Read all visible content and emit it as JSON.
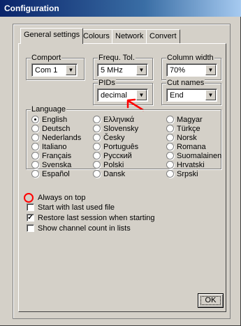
{
  "window": {
    "title": "Configuration"
  },
  "tabs": [
    {
      "label": "General settings"
    },
    {
      "label": "Colours"
    },
    {
      "label": "Network"
    },
    {
      "label": "Convert"
    }
  ],
  "comport": {
    "label": "Comport",
    "value": "Com 1"
  },
  "frequ_tol": {
    "label": "Frequ. Tol.",
    "value": "5 MHz"
  },
  "column_width": {
    "label": "Column width",
    "value": "70%"
  },
  "pids": {
    "label": "PIDs",
    "value": "decimal"
  },
  "cut_names": {
    "label": "Cut names",
    "value": "End"
  },
  "language": {
    "label": "Language",
    "selected": "English",
    "options": [
      "English",
      "Deutsch",
      "Nederlands",
      "Italiano",
      "Français",
      "Svenska",
      "Español",
      "Ελληνικά",
      "Slovensky",
      "Česky",
      "Português",
      "Русский",
      "Polski",
      "Dansk",
      "Magyar",
      "Türkçe",
      "Norsk",
      "Romana",
      "Suomalainen",
      "Hrvatski",
      "Srpski"
    ]
  },
  "options": [
    {
      "label": "Always on top",
      "checked": false
    },
    {
      "label": "Start with last used file",
      "checked": false
    },
    {
      "label": "Restore last session when starting",
      "checked": true
    },
    {
      "label": "Show channel count in lists",
      "checked": false
    }
  ],
  "ok_button": {
    "label": "OK"
  },
  "annotations": {
    "color": "#ff0000"
  }
}
